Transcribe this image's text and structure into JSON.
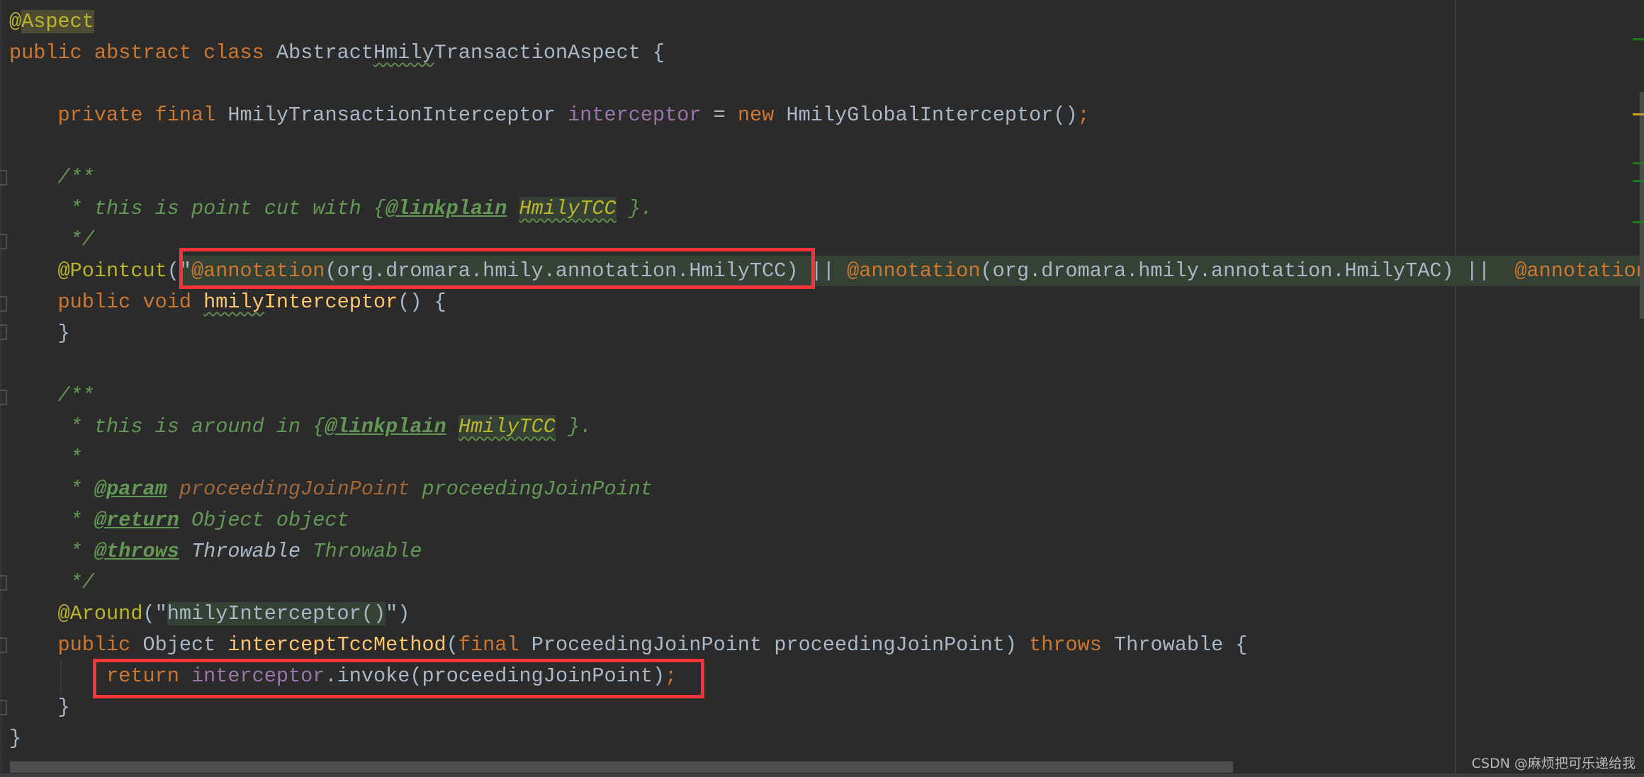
{
  "editor": {
    "lines": {
      "l0": {
        "at": "@",
        "aspect": "Aspect"
      },
      "l1": {
        "public": "public",
        "abstract": "abstract",
        "class": "class",
        "name_a": "Abstract",
        "name_b": "Hmily",
        "name_c": "TransactionAspect",
        "brace": " {"
      },
      "l3": {
        "private": "private",
        "final": "final",
        "type": "HmilyTransactionInterceptor",
        "field": "interceptor",
        "eq": " = ",
        "new": "new",
        "ctor": "HmilyGlobalInterceptor()",
        "semi": ";"
      },
      "l5": {
        "text": "/**"
      },
      "l6": {
        "pre": " * this is point cut with {",
        "tag": "@linkplain",
        "ref": "HmilyTCC",
        "post": " }."
      },
      "l7": {
        "text": " */"
      },
      "l8": {
        "ann": "@Pointcut",
        "open": "(\"",
        "a1": "@annotation",
        "p1": "(org.dromara.hmily.annotation.HmilyTCC) ",
        "or1": "||",
        "a2": "@annotation",
        "p2": "(org.dromara.hmily.annotation.HmilyTAC) ",
        "or2": "||",
        "a3": "@annotation",
        "p3": "("
      },
      "l9": {
        "public": "public",
        "void": "void",
        "fn_a": "hmily",
        "fn_b": "Interceptor",
        "rest": "() {"
      },
      "l10": {
        "text": "}"
      },
      "l12": {
        "text": "/**"
      },
      "l13": {
        "pre": " * this is around in {",
        "tag": "@linkplain",
        "ref": "HmilyTCC",
        "post": " }."
      },
      "l14": {
        "text": " *"
      },
      "l15": {
        "star": " * ",
        "tag": "@param",
        "pname": "proceedingJoinPoint",
        "desc": " proceedingJoinPoint"
      },
      "l16": {
        "star": " * ",
        "tag": "@return",
        "desc": " Object object"
      },
      "l17": {
        "star": " * ",
        "tag": "@throws",
        "type": "Throwable",
        "desc": " Throwable"
      },
      "l18": {
        "text": " */"
      },
      "l19": {
        "ann": "@Around",
        "open": "(\"",
        "value": "hmilyInterceptor()",
        "close": "\")"
      },
      "l20": {
        "public": "public",
        "type": "Object",
        "fn": "interceptTccMethod",
        "open": "(",
        "final": "final",
        "ptype": "ProceedingJoinPoint",
        "pname": "proceedingJoinPoint",
        "close": ") ",
        "throws": "throws",
        "ex": "Throwable",
        "brace": " {"
      },
      "l21": {
        "return": "return",
        "field": "interceptor",
        "call": ".invoke(proceedingJoinPoint)",
        "semi": ";"
      },
      "l22": {
        "text": "}"
      },
      "l23": {
        "text": "}"
      }
    },
    "highlight_color": "#f5343a",
    "error_stripe_markers": [
      {
        "kind": "green",
        "color": "#1f7a1f"
      },
      {
        "kind": "yellow",
        "color": "#c9a227"
      },
      {
        "kind": "green",
        "color": "#1f7a1f"
      },
      {
        "kind": "green",
        "color": "#1f7a1f"
      },
      {
        "kind": "green",
        "color": "#1f7a1f"
      }
    ]
  },
  "watermark": "CSDN @麻烦把可乐递给我"
}
